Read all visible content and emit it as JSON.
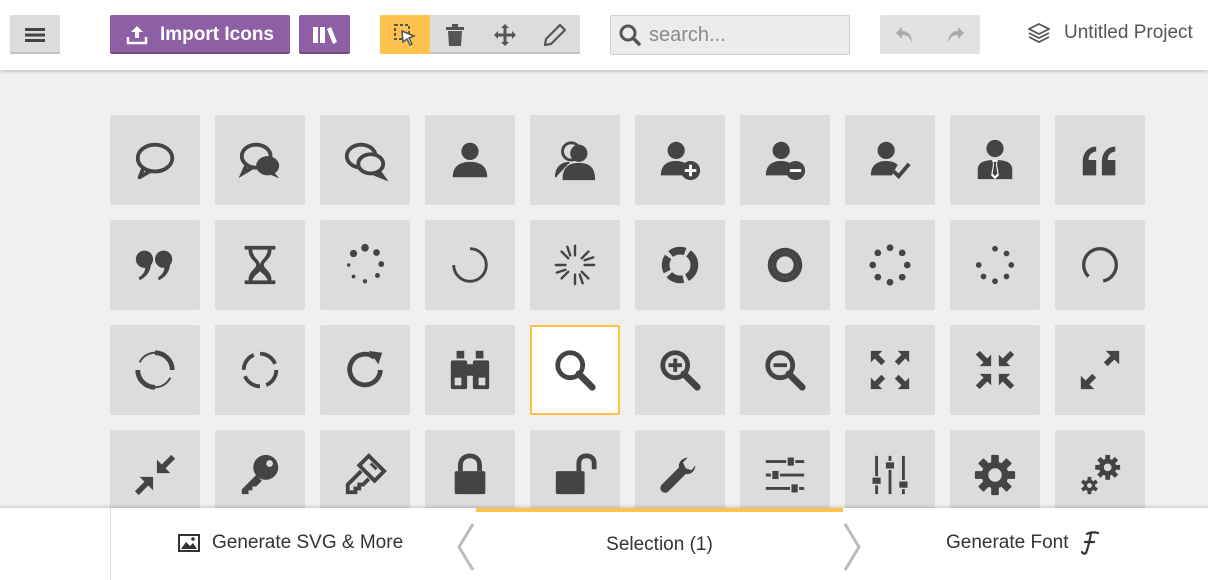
{
  "toolbar": {
    "import_label": "Import Icons",
    "search_placeholder": "search...",
    "project_name": "Untitled Project"
  },
  "grid": {
    "rows": [
      [
        "database-icon",
        "comment-icon",
        "bubble-icon",
        "bubbles-icon",
        "bubbles2-icon",
        "bubble2-icon",
        "bubbles3-icon",
        "bubbles4-icon",
        "users-chat-icon",
        "user-bubble-icon"
      ],
      [
        "bubble-icon",
        "bubbles-icon",
        "bubbles2-icon",
        "user-icon",
        "users-icon",
        "user-plus-icon",
        "user-minus-icon",
        "user-check-icon",
        "user-tie-icon",
        "quotes-left-icon"
      ],
      [
        "quotes-right-icon",
        "hour-glass-icon",
        "spinner-icon",
        "spinner2-icon",
        "spinner3-icon",
        "spinner4-icon",
        "spinner5-icon",
        "spinner6-icon",
        "spinner7-icon",
        "spinner8-icon"
      ],
      [
        "spinner9-icon",
        "spinner10-icon",
        "spinner11-icon",
        "binoculars-icon",
        "search-icon",
        "zoom-in-icon",
        "zoom-out-icon",
        "enlarge-icon",
        "shrink-icon",
        "enlarge2-icon"
      ],
      [
        "shrink2-icon",
        "key-icon",
        "key2-icon",
        "lock-icon",
        "unlocked-icon",
        "wrench-icon",
        "equalizer-icon",
        "equalizer2-icon",
        "cog-icon",
        "cogs-icon"
      ]
    ],
    "selected_icon": "search-icon"
  },
  "bottombar": {
    "generate_svg_label": "Generate SVG & More",
    "selection_label": "Selection (1)",
    "generate_font_label": "Generate Font"
  },
  "colors": {
    "accent": "#ffc34d",
    "brand": "#8e5fa5",
    "icon": "#444444",
    "cell": "#dcdcdc"
  }
}
